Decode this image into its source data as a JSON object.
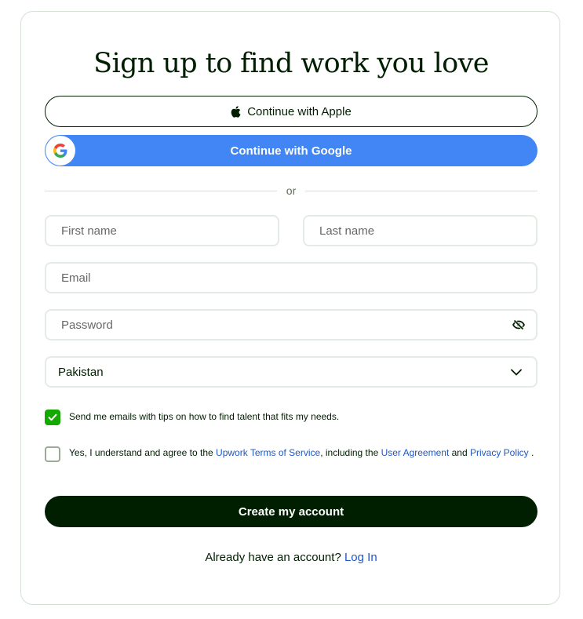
{
  "title": "Sign up to find work you love",
  "social": {
    "apple_label": "Continue with Apple",
    "google_label": "Continue with Google"
  },
  "divider_text": "or",
  "form": {
    "first_name_placeholder": "First name",
    "last_name_placeholder": "Last name",
    "email_placeholder": "Email",
    "password_placeholder": "Password",
    "country_value": "Pakistan"
  },
  "consent": {
    "emails_checked": true,
    "emails_text": "Send me emails with tips on how to find talent that fits my needs.",
    "terms_checked": false,
    "terms_prefix": "Yes, I understand and agree to the ",
    "terms_link": "Upwork Terms of Service",
    "terms_middle": ", including the ",
    "user_agreement_link": "User Agreement",
    "terms_and": " and ",
    "privacy_link": "Privacy Policy",
    "terms_suffix": " ."
  },
  "create_button_label": "Create my account",
  "login": {
    "prompt": "Already have an account?",
    "link": "Log In"
  },
  "colors": {
    "brand_dark": "#001e00",
    "google_blue": "#4285f4",
    "check_green": "#14a800",
    "link_blue": "#1f57c3"
  }
}
